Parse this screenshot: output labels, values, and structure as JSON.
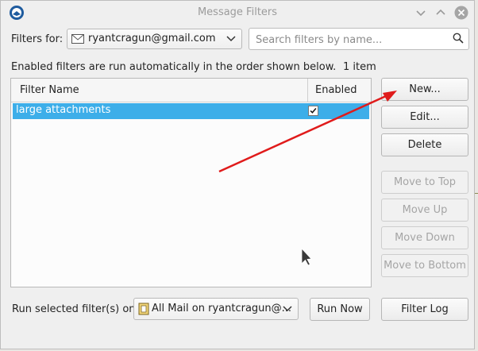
{
  "window": {
    "title": "Message Filters"
  },
  "filters_for": {
    "label": "Filters for:",
    "account": "ryantcragun@gmail.com"
  },
  "search": {
    "placeholder": "Search filters by name..."
  },
  "info": {
    "text": "Enabled filters are run automatically in the order shown below.",
    "count": "1 item"
  },
  "list": {
    "columns": [
      "Filter Name",
      "Enabled"
    ],
    "rows": [
      {
        "name": "large attachments",
        "enabled": true
      }
    ]
  },
  "buttons": {
    "new": "New...",
    "edit": "Edit...",
    "delete": "Delete",
    "move_to_top": "Move to Top",
    "move_up": "Move Up",
    "move_down": "Move Down",
    "move_to_bottom": "Move to Bottom",
    "run_now": "Run Now",
    "filter_log": "Filter Log"
  },
  "run_on": {
    "label": "Run selected filter(s) on:",
    "folder": "All Mail on ryantcragun@..."
  },
  "colors": {
    "selection": "#3daee9",
    "annotation_arrow": "#e01b1b",
    "window_bg": "#efefef"
  },
  "icons": [
    "thunderbird-icon",
    "minimize-icon",
    "maximize-icon",
    "close-icon",
    "envelope-icon",
    "chevron-down-icon",
    "search-icon",
    "folder-icon",
    "mouse-cursor-icon"
  ]
}
